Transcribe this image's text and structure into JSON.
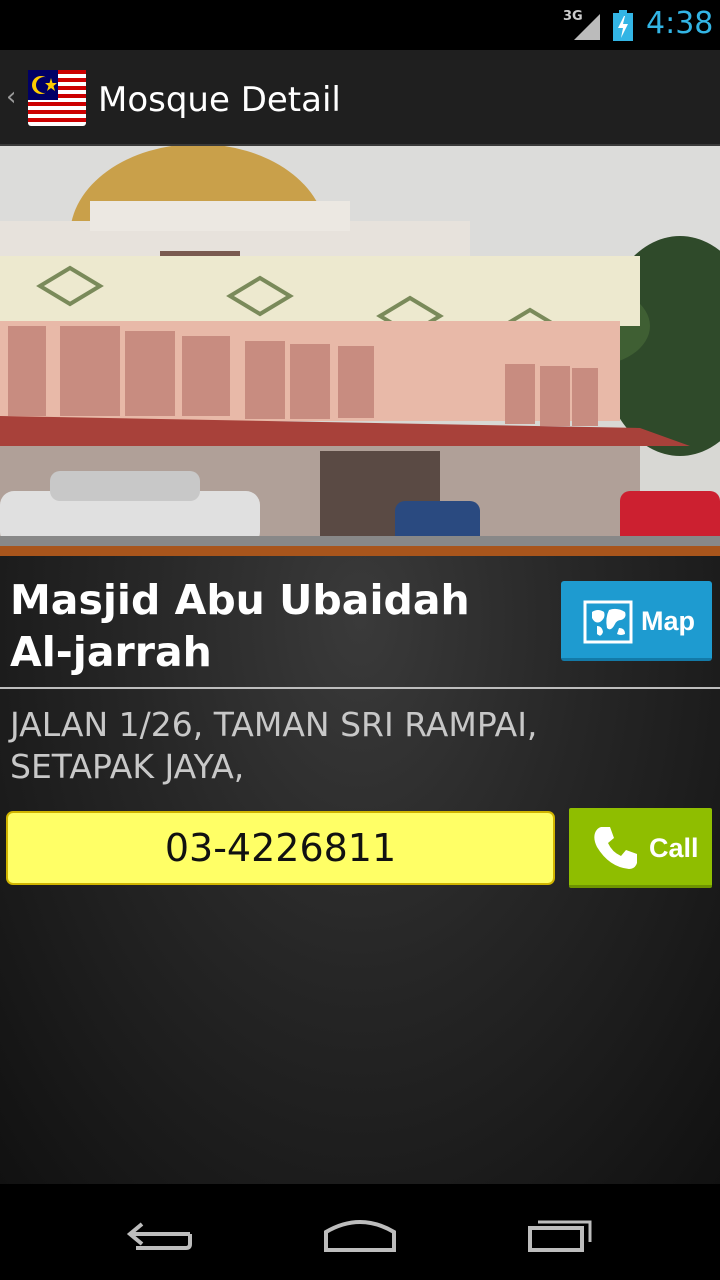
{
  "status_bar": {
    "network": "3G",
    "time": "4:38",
    "icons": [
      "signal-icon",
      "battery-charging-icon"
    ],
    "accent_color": "#33b5e5"
  },
  "action_bar": {
    "title": "Mosque Detail",
    "icons": [
      "up-caret-icon",
      "malaysia-flag-icon"
    ]
  },
  "mosque": {
    "name": "Masjid Abu Ubaidah Al-jarrah",
    "address": "JALAN 1/26, TAMAN SRI RAMPAI, SETAPAK JAYA,",
    "phone": "03-4226811"
  },
  "buttons": {
    "map_label": "Map",
    "map_color": "#1e9bd0",
    "call_label": "Call",
    "call_color": "#8fbe00"
  },
  "phone_field_color": "#ffff66",
  "nav_bar": {
    "icons": [
      "back-icon",
      "home-icon",
      "recent-apps-icon"
    ]
  }
}
